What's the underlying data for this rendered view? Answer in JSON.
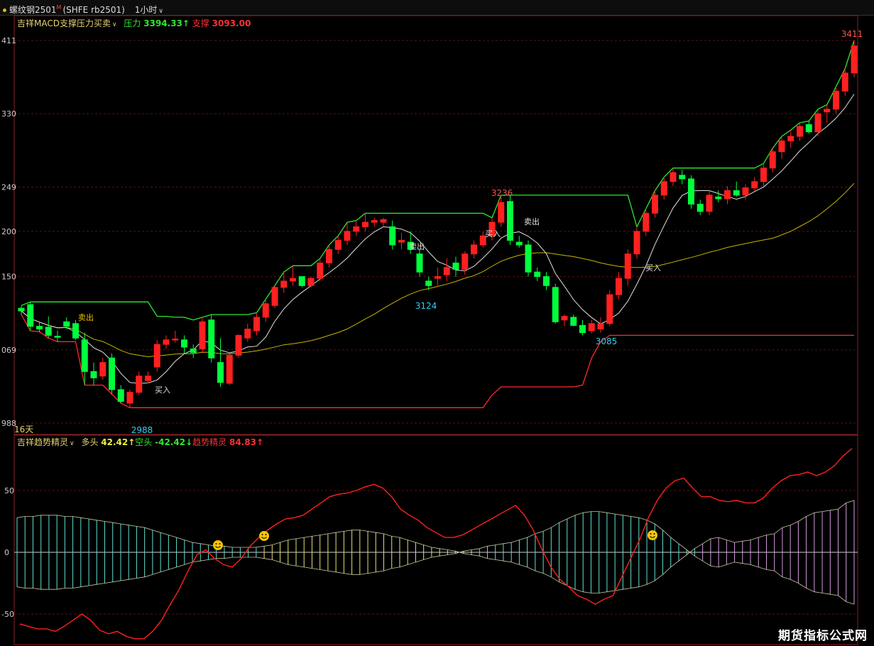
{
  "header": {
    "symbol_name": "螺纹钢2501",
    "symbol_mark": "M",
    "symbol_code": "(SHFE rb2501)",
    "period": "1小时",
    "period_caret": "∨"
  },
  "main_panel": {
    "indicator_name": "吉祥MACD支撑压力买卖",
    "indicator_caret": "∨",
    "pressure_label": "压力",
    "pressure_value": "3394.33↑",
    "support_label": "支撑",
    "support_value": "3093.00",
    "days_label": "16天",
    "y_tick_labels": [
      "411",
      "330",
      "249",
      "200",
      "150",
      "069",
      "988"
    ],
    "price_labels": {
      "high_end": "3411",
      "peak": "3236",
      "low_start": "2988",
      "mid_low": "3124",
      "low2": "3085"
    },
    "signal_labels": {
      "sell1": "卖出",
      "buy1": "买入",
      "sell2": "卖出",
      "buy2": "买入",
      "sell3": "卖出",
      "buy3": "买入"
    }
  },
  "sub_panel": {
    "indicator_name": "吉祥趋势精灵",
    "indicator_caret": "∨",
    "long_label": "多头",
    "long_value": "42.42↑",
    "short_label": "空头",
    "short_value": "-42.42↓",
    "trend_label": "趋势精灵",
    "trend_value": "84.83↑",
    "y_tick_labels": [
      "50",
      "0",
      "-50"
    ]
  },
  "watermark": "期货指标公式网",
  "colors": {
    "up": "#ff2020",
    "down": "#00ff3c",
    "pressure_line": "#2fe82f",
    "support_line": "#ff2a2a",
    "ma_short": "#e0e0e0",
    "ma_long": "#c8b400",
    "hist_cyan": "#5ee0d0",
    "hist_yellow": "#e8e070",
    "hist_pink": "#d79be0",
    "trend_line": "#ff2020",
    "label_cyan": "#33ccee",
    "label_red": "#ff5050"
  },
  "chart_data": [
    {
      "type": "candlestick",
      "title": "吉祥MACD支撑压力买卖",
      "ylim": [
        2988,
        3411
      ],
      "candles": [
        [
          3115,
          3118,
          3108,
          3112
        ],
        [
          3119,
          3122,
          3090,
          3095
        ],
        [
          3095,
          3100,
          3089,
          3092
        ],
        [
          3094,
          3106,
          3082,
          3085
        ],
        [
          3084,
          3090,
          3078,
          3083
        ],
        [
          3100,
          3105,
          3092,
          3095
        ],
        [
          3098,
          3102,
          3080,
          3082
        ],
        [
          3080,
          3088,
          3030,
          3045
        ],
        [
          3045,
          3055,
          3030,
          3038
        ],
        [
          3040,
          3060,
          3036,
          3055
        ],
        [
          3060,
          3065,
          3020,
          3025
        ],
        [
          3025,
          3030,
          3010,
          3012
        ],
        [
          3010,
          3025,
          3005,
          3022
        ],
        [
          3022,
          3045,
          3019,
          3040
        ],
        [
          3035,
          3045,
          3032,
          3040
        ],
        [
          3050,
          3080,
          3045,
          3075
        ],
        [
          3075,
          3085,
          3070,
          3080
        ],
        [
          3080,
          3090,
          3077,
          3081
        ],
        [
          3080,
          3085,
          3065,
          3072
        ],
        [
          3070,
          3075,
          3060,
          3066
        ],
        [
          3070,
          3105,
          3065,
          3100
        ],
        [
          3102,
          3108,
          3055,
          3060
        ],
        [
          3055,
          3082,
          3028,
          3033
        ],
        [
          3032,
          3065,
          3030,
          3063
        ],
        [
          3063,
          3086,
          3060,
          3085
        ],
        [
          3082,
          3098,
          3078,
          3092
        ],
        [
          3090,
          3110,
          3085,
          3105
        ],
        [
          3105,
          3125,
          3100,
          3120
        ],
        [
          3118,
          3140,
          3115,
          3138
        ],
        [
          3138,
          3155,
          3132,
          3145
        ],
        [
          3145,
          3162,
          3140,
          3148
        ],
        [
          3150,
          3145,
          3138,
          3140
        ],
        [
          3140,
          3150,
          3138,
          3148
        ],
        [
          3148,
          3170,
          3145,
          3165
        ],
        [
          3165,
          3185,
          3160,
          3180
        ],
        [
          3180,
          3195,
          3175,
          3190
        ],
        [
          3190,
          3210,
          3185,
          3200
        ],
        [
          3200,
          3212,
          3195,
          3205
        ],
        [
          3205,
          3220,
          3200,
          3210
        ],
        [
          3210,
          3215,
          3205,
          3212
        ],
        [
          3210,
          3215,
          3205,
          3213
        ],
        [
          3205,
          3212,
          3180,
          3185
        ],
        [
          3188,
          3198,
          3180,
          3190
        ],
        [
          3188,
          3200,
          3175,
          3180
        ],
        [
          3175,
          3180,
          3150,
          3155
        ],
        [
          3145,
          3150,
          3135,
          3140
        ],
        [
          3148,
          3160,
          3140,
          3150
        ],
        [
          3152,
          3170,
          3145,
          3160
        ],
        [
          3165,
          3172,
          3150,
          3158
        ],
        [
          3158,
          3178,
          3152,
          3175
        ],
        [
          3175,
          3190,
          3170,
          3185
        ],
        [
          3185,
          3200,
          3182,
          3195
        ],
        [
          3195,
          3215,
          3190,
          3210
        ],
        [
          3210,
          3240,
          3205,
          3232
        ],
        [
          3233,
          3240,
          3185,
          3190
        ],
        [
          3188,
          3195,
          3182,
          3185
        ],
        [
          3185,
          3190,
          3150,
          3155
        ],
        [
          3155,
          3160,
          3145,
          3150
        ],
        [
          3150,
          3155,
          3135,
          3140
        ],
        [
          3138,
          3142,
          3098,
          3100
        ],
        [
          3102,
          3108,
          3095,
          3106
        ],
        [
          3105,
          3108,
          3095,
          3096
        ],
        [
          3096,
          3102,
          3085,
          3088
        ],
        [
          3090,
          3102,
          3087,
          3098
        ],
        [
          3092,
          3105,
          3088,
          3098
        ],
        [
          3098,
          3135,
          3095,
          3130
        ],
        [
          3130,
          3155,
          3125,
          3148
        ],
        [
          3148,
          3180,
          3140,
          3175
        ],
        [
          3175,
          3205,
          3170,
          3200
        ],
        [
          3200,
          3225,
          3195,
          3220
        ],
        [
          3220,
          3245,
          3215,
          3240
        ],
        [
          3240,
          3260,
          3235,
          3255
        ],
        [
          3255,
          3270,
          3250,
          3265
        ],
        [
          3262,
          3268,
          3252,
          3258
        ],
        [
          3258,
          3262,
          3225,
          3230
        ],
        [
          3230,
          3235,
          3218,
          3222
        ],
        [
          3222,
          3245,
          3218,
          3240
        ],
        [
          3238,
          3245,
          3232,
          3236
        ],
        [
          3236,
          3250,
          3230,
          3245
        ],
        [
          3245,
          3255,
          3238,
          3240
        ],
        [
          3240,
          3252,
          3235,
          3248
        ],
        [
          3248,
          3260,
          3245,
          3255
        ],
        [
          3255,
          3275,
          3250,
          3270
        ],
        [
          3270,
          3292,
          3265,
          3288
        ],
        [
          3288,
          3305,
          3280,
          3300
        ],
        [
          3300,
          3312,
          3292,
          3305
        ],
        [
          3305,
          3320,
          3300,
          3316
        ],
        [
          3318,
          3322,
          3308,
          3310
        ],
        [
          3310,
          3335,
          3305,
          3330
        ],
        [
          3332,
          3340,
          3320,
          3335
        ],
        [
          3335,
          3360,
          3330,
          3355
        ],
        [
          3355,
          3380,
          3350,
          3375
        ],
        [
          3375,
          3411,
          3370,
          3405
        ]
      ]
    },
    {
      "type": "line",
      "title": "吉祥趋势精灵",
      "ylim": [
        -75,
        85
      ],
      "series": [
        {
          "name": "多头",
          "values": [
            28,
            29,
            29,
            30,
            30,
            30,
            29,
            29,
            28,
            27,
            26,
            25,
            24,
            23,
            22,
            21,
            20,
            18,
            16,
            14,
            12,
            10,
            8,
            7,
            6,
            5,
            5,
            4,
            4,
            4,
            4,
            5,
            6,
            8,
            10,
            11,
            12,
            13,
            14,
            15,
            16,
            17,
            18,
            18,
            17,
            16,
            15,
            13,
            12,
            10,
            8,
            6,
            4,
            3,
            2,
            1,
            -1,
            -2,
            -3,
            -5,
            -6,
            -7,
            -8,
            -10,
            -12,
            -15,
            -17,
            -20,
            -24,
            -27,
            -30,
            -32,
            -33,
            -33,
            -32,
            -31,
            -30,
            -29,
            -28,
            -26,
            -23,
            -18,
            -12,
            -7,
            -2,
            3,
            7,
            11,
            12,
            10,
            8,
            9,
            10,
            12,
            14,
            15,
            20,
            22,
            25,
            29,
            32,
            33,
            34,
            35,
            40,
            42
          ]
        },
        {
          "name": "空头",
          "values": [
            -28,
            -29,
            -29,
            -30,
            -30,
            -30,
            -29,
            -29,
            -28,
            -27,
            -26,
            -25,
            -24,
            -23,
            -22,
            -21,
            -20,
            -18,
            -16,
            -14,
            -12,
            -10,
            -8,
            -7,
            -6,
            -5,
            -5,
            -4,
            -4,
            -4,
            -4,
            -5,
            -6,
            -8,
            -10,
            -11,
            -12,
            -13,
            -14,
            -15,
            -16,
            -17,
            -18,
            -18,
            -17,
            -16,
            -15,
            -13,
            -12,
            -10,
            -8,
            -6,
            -4,
            -3,
            -2,
            -1,
            1,
            2,
            3,
            5,
            6,
            7,
            8,
            10,
            12,
            15,
            17,
            20,
            24,
            27,
            30,
            32,
            33,
            33,
            32,
            31,
            30,
            29,
            28,
            26,
            23,
            18,
            12,
            7,
            2,
            -3,
            -7,
            -11,
            -12,
            -10,
            -8,
            -9,
            -10,
            -12,
            -14,
            -15,
            -20,
            -22,
            -25,
            -29,
            -32,
            -33,
            -34,
            -35,
            -40,
            -42
          ]
        },
        {
          "name": "趋势精灵",
          "values": [
            -58,
            -60,
            -62,
            -62,
            -64,
            -60,
            -55,
            -50,
            -55,
            -63,
            -66,
            -64,
            -68,
            -70,
            -70,
            -64,
            -55,
            -42,
            -30,
            -15,
            -2,
            2,
            -5,
            -10,
            -12,
            -5,
            5,
            12,
            18,
            23,
            27,
            28,
            30,
            35,
            40,
            45,
            47,
            48,
            50,
            53,
            55,
            52,
            45,
            35,
            30,
            26,
            20,
            16,
            12,
            12,
            14,
            18,
            22,
            26,
            30,
            34,
            38,
            30,
            18,
            2,
            -12,
            -22,
            -28,
            -35,
            -38,
            -42,
            -38,
            -35,
            -20,
            -5,
            10,
            28,
            42,
            52,
            58,
            60,
            52,
            45,
            45,
            42,
            41,
            42,
            40,
            40,
            44,
            52,
            58,
            62,
            63,
            65,
            62,
            65,
            70,
            78,
            84
          ]
        }
      ]
    }
  ]
}
